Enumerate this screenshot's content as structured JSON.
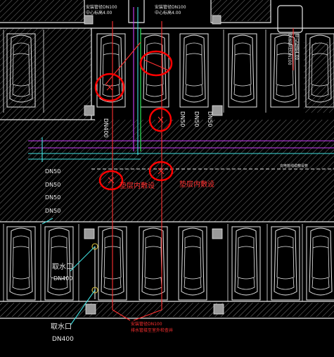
{
  "labels": {
    "top_note_1_line1": "安装管径DN100",
    "top_note_1_line2": "中心标高4.00",
    "top_note_2_line1": "安装管径DN100",
    "top_note_2_line2": "中心标高4.00",
    "top_right_note_line1": "安装管径DN100",
    "top_right_note_line2": "中心标高4.00",
    "dn400_vertical": "DN400",
    "dn50_a": "DN50",
    "dn50_b": "DN50",
    "dn50_c": "DN50",
    "left_dn50_1": "DN50",
    "left_dn50_2": "DN50",
    "left_dn50_3": "DN50",
    "left_dn50_4": "DN50",
    "right_line_note": "充电桩线缆敷设管",
    "floor_lay_1": "垫层内敷设",
    "floor_lay_2": "垫层内敷设",
    "drain_inlet_1": "取水口",
    "drain_dn_1": "DN400",
    "drain_inlet_2": "取水口",
    "drain_dn_2": "DN400",
    "bottom_note_line1": "安装管径DN100",
    "bottom_note_line2": "排水管接至室外检查井"
  },
  "colors": {
    "background": "#000000",
    "lines": "#e8e8e8",
    "hatch": "#7a7a7a",
    "pipe_red": "#ff3030",
    "pipe_magenta": "#d040ff",
    "pipe_cyan": "#40e0e0",
    "pipe_green": "#30ff60",
    "markup": "#ff0000"
  }
}
